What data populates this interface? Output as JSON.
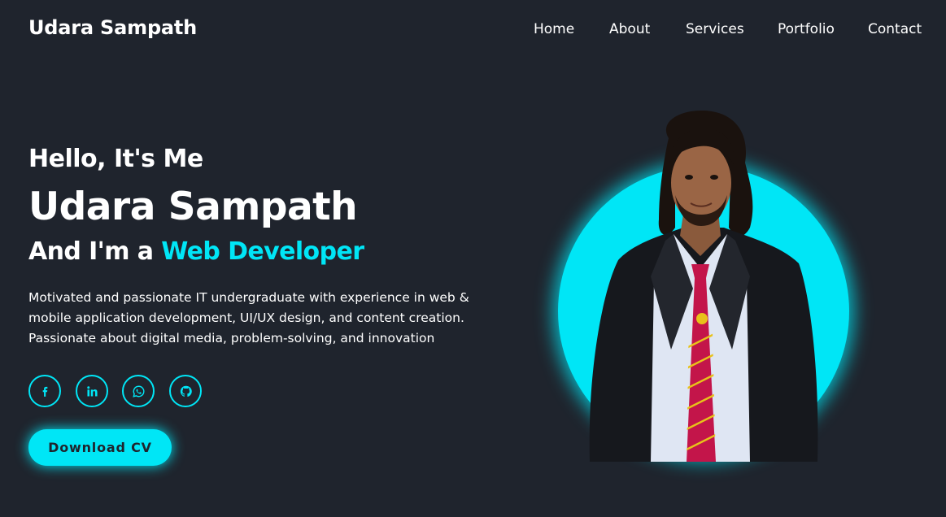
{
  "header": {
    "logo": "Udara Sampath",
    "nav": [
      "Home",
      "About",
      "Services",
      "Portfolio",
      "Contact"
    ]
  },
  "hero": {
    "greeting": "Hello, It's Me",
    "name": "Udara Sampath",
    "role_prefix": "And I'm a ",
    "role_highlight": "Web Developer",
    "description_lines": [
      "Motivated and passionate IT undergraduate with experience in web &",
      "mobile application development, UI/UX design, and content creation.",
      "Passionate about digital media, problem-solving, and innovation"
    ],
    "socials": [
      "facebook-icon",
      "linkedin-icon",
      "whatsapp-icon",
      "github-icon"
    ],
    "download_button": "Download CV"
  },
  "colors": {
    "background": "#1f242d",
    "accent": "#00e6f6",
    "text": "#ffffff"
  }
}
